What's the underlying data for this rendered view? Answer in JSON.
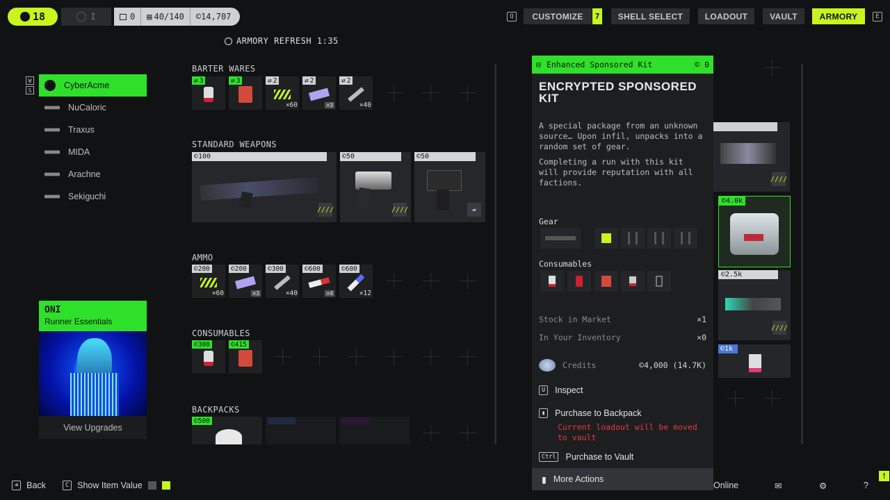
{
  "topbar": {
    "level": "18",
    "rank": "I",
    "tokens": "0",
    "capacity": "40/140",
    "credits": "14,707",
    "currency_symbol": "©",
    "nav": [
      {
        "key": "Q",
        "label": "CUSTOMIZE",
        "badge": "7"
      },
      {
        "label": "SHELL SELECT"
      },
      {
        "label": "LOADOUT"
      },
      {
        "label": "VAULT"
      },
      {
        "label": "ARMORY",
        "active": true,
        "key": "E"
      }
    ]
  },
  "refresh": "ARMORY REFRESH 1:35",
  "sidebar": {
    "keys": [
      "W",
      "S"
    ],
    "factions": [
      "CyberAcme",
      "NuCaloric",
      "Traxus",
      "MIDA",
      "Arachne",
      "Sekiguchi"
    ],
    "card": {
      "title": "ONI",
      "subtitle": "Runner Essentials",
      "button": "View Upgrades"
    }
  },
  "sections": {
    "barter": {
      "title": "BARTER WARES",
      "items": [
        {
          "tag": "3",
          "qty": ""
        },
        {
          "tag": "3",
          "qty": ""
        },
        {
          "tag": "2",
          "qty": "×60"
        },
        {
          "tag": "2",
          "qty": "×3"
        },
        {
          "tag": "2",
          "qty": "×40"
        }
      ]
    },
    "weapons": {
      "title": "STANDARD WEAPONS",
      "items": [
        {
          "price": "©100"
        },
        {
          "price": "©50"
        },
        {
          "price": "©50"
        }
      ]
    },
    "ammo": {
      "title": "AMMO",
      "items": [
        {
          "price": "©200",
          "qty": "×60"
        },
        {
          "price": "©200",
          "qty": "×3"
        },
        {
          "price": "©300",
          "qty": "×40"
        },
        {
          "price": "©600",
          "qty": "×4"
        },
        {
          "price": "©600",
          "qty": "×12"
        }
      ]
    },
    "consumables": {
      "title": "CONSUMABLES",
      "items": [
        {
          "price": "©300"
        },
        {
          "price": "©415"
        }
      ]
    },
    "backpacks": {
      "title": "BACKPACKS",
      "items": [
        {
          "price": "©500"
        }
      ]
    }
  },
  "detail": {
    "header": "Enhanced Sponsored Kit",
    "header_price": "© 0",
    "title": "ENCRYPTED SPONSORED KIT",
    "desc1": "A special package from an unknown source… Upon infil, unpacks into a random set of gear.",
    "desc2": "Completing a run with this kit will provide reputation with all factions.",
    "gear_label": "Gear",
    "consumables_label": "Consumables",
    "stock_label": "Stock in Market",
    "stock_value": "×1",
    "inventory_label": "In Your Inventory",
    "inventory_value": "×0",
    "credits_label": "Credits",
    "credits_value": "©4,000 (14.7K)",
    "actions": {
      "inspect": "Inspect",
      "inspect_key": "U",
      "backpack": "Purchase to Backpack",
      "warning": "Current loadout will be moved to vault",
      "vault": "Purchase to Vault",
      "vault_key": "Ctrl",
      "more": "More Actions"
    }
  },
  "right_column": {
    "prices": [
      "©4.0k",
      "©2.5k",
      "©1k"
    ]
  },
  "bottom": {
    "back": "Back",
    "show_value": "Show Item Value",
    "online": "Online"
  },
  "colors": {
    "accent": "#c7f51d",
    "green": "#2fe02b",
    "warning": "#e43a3a"
  }
}
